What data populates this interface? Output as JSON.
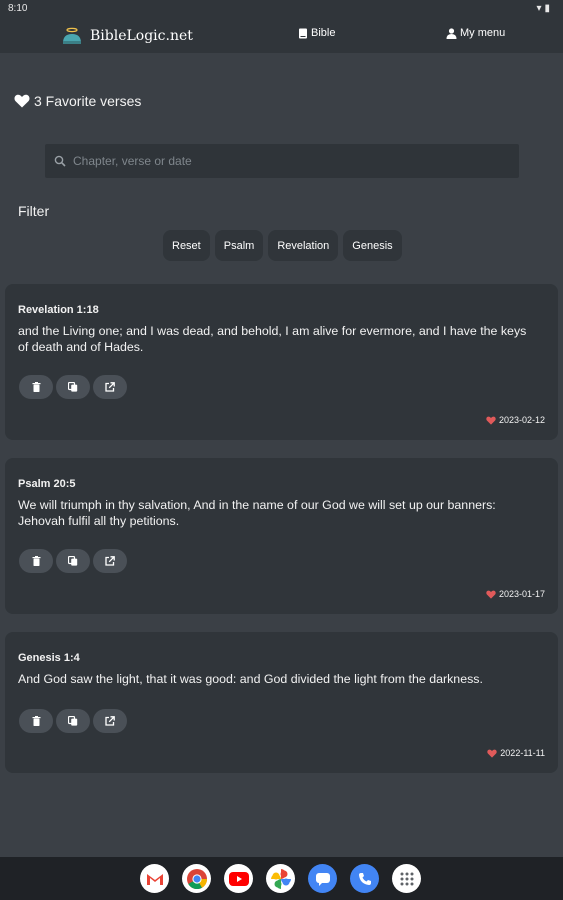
{
  "status_bar": {
    "time": "8:10"
  },
  "nav": {
    "brand": "BibleLogic.net",
    "bible_label": "Bible",
    "my_menu_label": "My menu"
  },
  "favorites": {
    "count_label": "3 Favorite verses"
  },
  "search": {
    "placeholder": "Chapter, verse or date",
    "value": ""
  },
  "filter": {
    "label": "Filter",
    "chips": [
      "Reset",
      "Psalm",
      "Revelation",
      "Genesis"
    ]
  },
  "verses": [
    {
      "reference": "Revelation 1:18",
      "text": "and the Living one; and I was dead, and behold, I am alive for evermore, and I have the keys of death and of Hades.",
      "date": "2023-02-12"
    },
    {
      "reference": "Psalm 20:5",
      "text": "We will triumph in thy salvation, And in the name of our God we will set up our banners: Jehovah fulfil all thy petitions.",
      "date": "2023-01-17"
    },
    {
      "reference": "Genesis 1:4",
      "text": "And God saw the light, that it was good: and God divided the light from the darkness.",
      "date": "2022-11-11"
    }
  ],
  "icons": {
    "delete": "trash-icon",
    "copy": "copy-icon",
    "share": "external-link-icon",
    "favorite": "heart-icon"
  },
  "colors": {
    "background": "#3b4046",
    "card": "#30353a",
    "heart_accent": "#e05a5a"
  },
  "dock_apps": [
    "gmail-icon",
    "chrome-icon",
    "youtube-icon",
    "photos-icon",
    "messages-icon",
    "phone-icon",
    "app-drawer-icon"
  ]
}
